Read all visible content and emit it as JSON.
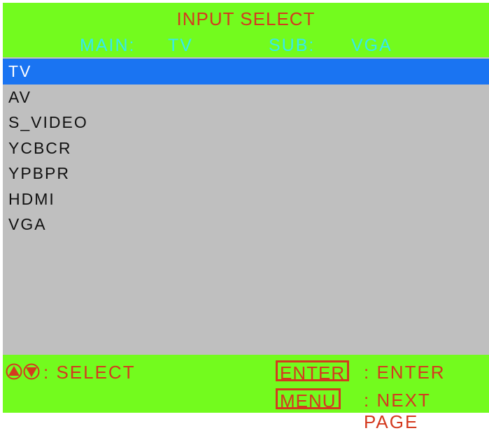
{
  "osd": {
    "title": "INPUT SELECT",
    "status": {
      "main_label": "MAIN:",
      "main_value": "TV",
      "sub_label": "SUB:",
      "sub_value": "VGA"
    },
    "sources": [
      "TV",
      "AV",
      "S_VIDEO",
      "YCBCR",
      "YPBPR",
      "HDMI",
      "VGA"
    ],
    "selected_source": "TV",
    "footer": {
      "select_hint": ": SELECT",
      "enter_key": "ENTER",
      "enter_hint": ": ENTER",
      "menu_key": "MENU",
      "menu_hint": ": NEXT PAGE",
      "nav_icons": [
        "up-arrow-icon",
        "down-arrow-icon"
      ]
    }
  },
  "colors": {
    "bar_green": "#73fb1e",
    "panel_gray": "#bfbfbf",
    "highlight_blue": "#1a74f2",
    "text_red": "#d43a1f",
    "status_cyan": "#35e9f0"
  }
}
